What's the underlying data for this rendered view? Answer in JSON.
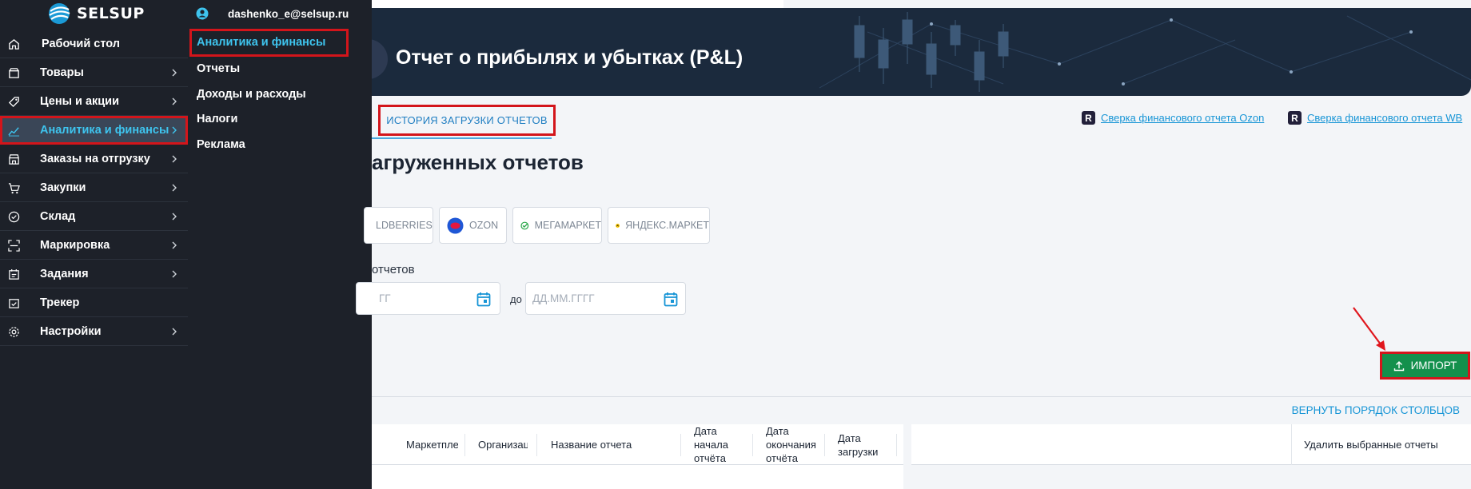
{
  "brand": {
    "name": "SELSUP"
  },
  "user": {
    "email": "dashenko_e@selsup.ru"
  },
  "sidebar": {
    "items": [
      {
        "label": "Рабочий стол",
        "icon": "home-icon"
      },
      {
        "label": "Товары",
        "icon": "box-icon"
      },
      {
        "label": "Цены и акции",
        "icon": "price-tag-icon"
      },
      {
        "label": "Аналитика и финансы",
        "icon": "chart-icon",
        "active": true
      },
      {
        "label": "Заказы на отгрузку",
        "icon": "store-icon"
      },
      {
        "label": "Закупки",
        "icon": "cart-icon"
      },
      {
        "label": "Склад",
        "icon": "check-circle-icon"
      },
      {
        "label": "Маркировка",
        "icon": "scan-icon"
      },
      {
        "label": "Задания",
        "icon": "task-icon"
      },
      {
        "label": "Трекер",
        "icon": "tracker-icon"
      },
      {
        "label": "Настройки",
        "icon": "gear-icon"
      }
    ]
  },
  "submenu": {
    "items": [
      {
        "label": "Аналитика и финансы",
        "active": true
      },
      {
        "label": "Отчеты"
      },
      {
        "label": "Доходы и расходы"
      },
      {
        "label": "Налоги"
      },
      {
        "label": "Реклама"
      }
    ]
  },
  "page": {
    "title": "Отчет о прибылях и убытках (P&L)",
    "tab_history": "ИСТОРИЯ ЗАГРУЗКИ ОТЧЕТОВ",
    "recon_ozon": "Сверка финансового отчета Ozon",
    "recon_wb": "Сверка финансового отчета WB",
    "section_title": "агруженных отчетов",
    "marketplaces": [
      "LDBERRIES",
      "OZON",
      "МЕГАМАРКЕТ",
      "ЯНДЕКС.МАРКЕТ"
    ],
    "date_label": "отчетов",
    "date_from_placeholder": "ГГ",
    "date_to_label": "до",
    "date_to_placeholder": "ДД.ММ.ГГГГ",
    "import_label": "ИМПОРТ",
    "restore_columns": "ВЕРНУТЬ ПОРЯДОК СТОЛБЦОВ",
    "delete_selected": "Удалить выбранные отчеты"
  },
  "table": {
    "columns": [
      "Маркетплейс",
      "Организация",
      "Название отчета",
      "Дата начала отчёта",
      "Дата окончания отчёта",
      "Дата загрузки"
    ]
  },
  "colors": {
    "sidebar_bg": "#1d2129",
    "accent_blue": "#3ec4ee",
    "highlight_red": "#d3151b",
    "import_green": "#13904c",
    "link_blue": "#1795d6"
  }
}
